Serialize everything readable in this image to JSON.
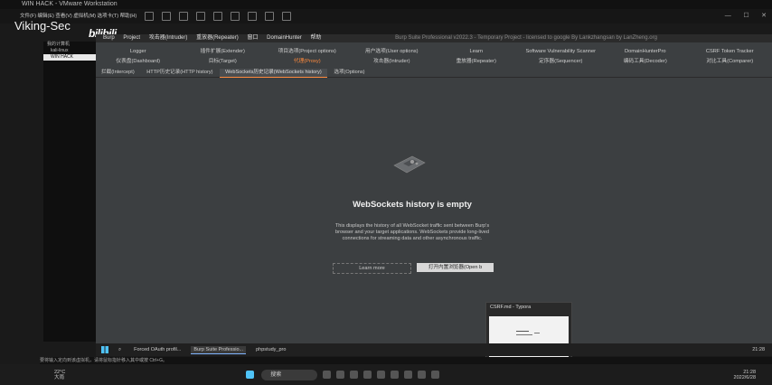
{
  "vm": {
    "title": "WIN HACK - VMware Workstation",
    "menu": "文件(F)   编辑(E)   查看(V)   虚拟机(M)   选项卡(T)   帮助(H)"
  },
  "watermark": {
    "text": "Viking-Sec",
    "logo": "bilibili"
  },
  "library": {
    "items": [
      "我的计算机",
      "kali-linux",
      "WIN HACK"
    ]
  },
  "burp": {
    "menu": [
      "Burp",
      "Project",
      "攻击器(Intruder)",
      "重放器(Repeater)",
      "窗口",
      "DomainHunter",
      "帮助"
    ],
    "title": "Burp Suite Professional v2022.3 - Temporary Project - licensed to google By Lankzhangsan by LanZheng.org",
    "row1": [
      "Logger",
      "插件扩展(Extender)",
      "项目选项(Project options)",
      "用户选项(User options)",
      "Learn",
      "Software Vulnerability Scanner",
      "DomainHunterPro",
      "CSRF Token Tracker"
    ],
    "row2": [
      "仪表盘(Dashboard)",
      "目标(Target)",
      "代理(Proxy)",
      "攻击器(Intruder)",
      "重放器(Repeater)",
      "定序器(Sequencer)",
      "编码工具(Decoder)",
      "对比工具(Comparer)"
    ],
    "subtabs": [
      "拦截(Intercept)",
      "HTTP历史记录(HTTP history)",
      "WebSockets历史记录(WebSockets history)",
      "选项(Options)"
    ],
    "empty_title": "WebSockets history is empty",
    "empty_desc": "This displays the history of all WebSocket traffic sent between Burp's browser and your target applications. WebSockets provide long-lived connections for streaming data and other asynchronous traffic.",
    "learn_label": "Learn more",
    "open_label": "打开内置浏览器(Open b"
  },
  "typora": {
    "title": "CSRF.md - Typora"
  },
  "guest_taskbar": {
    "items": [
      "Forced OAuth profil...",
      "Burp Suite Professio...",
      "phpstudy_pro"
    ],
    "clock": "21:28"
  },
  "status_text": "要将输入定向到该虚拟机，请将鼠标指针移入其中或按 Ctrl+G。",
  "host_taskbar": {
    "temp": "22°C",
    "weather": "大雨",
    "search": "搜索",
    "time": "21:28",
    "date": "2022/6/28"
  }
}
